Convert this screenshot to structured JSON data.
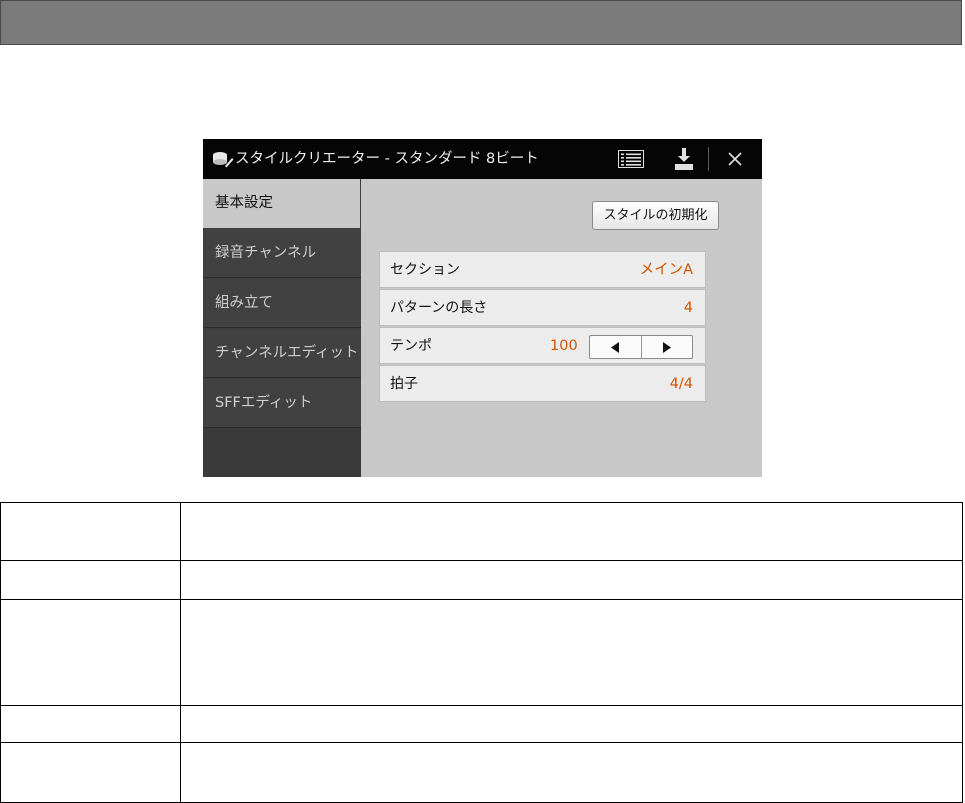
{
  "window": {
    "title": "スタイルクリエーター - スタンダード 8ビート",
    "icons": [
      "style-creator-icon",
      "list-icon",
      "save-icon",
      "close-icon"
    ]
  },
  "sidebar": {
    "tabs": [
      {
        "label": "基本設定",
        "active": true
      },
      {
        "label": "録音チャンネル",
        "active": false
      },
      {
        "label": "組み立て",
        "active": false
      },
      {
        "label": "チャンネルエディット",
        "active": false
      },
      {
        "label": "SFFエディット",
        "active": false
      }
    ]
  },
  "main": {
    "reset_button": "スタイルの初期化",
    "params": {
      "section": {
        "label": "セクション",
        "value": "メインA"
      },
      "pattern_length": {
        "label": "パターンの長さ",
        "value": "4"
      },
      "tempo": {
        "label": "テンポ",
        "value": "100"
      },
      "time_signature": {
        "label": "拍子",
        "value": "4/4"
      }
    }
  },
  "colors": {
    "value_accent": "#d35400",
    "titlebar": "#050505",
    "sidebar": "#414141",
    "panel": "#c8c8c8"
  }
}
